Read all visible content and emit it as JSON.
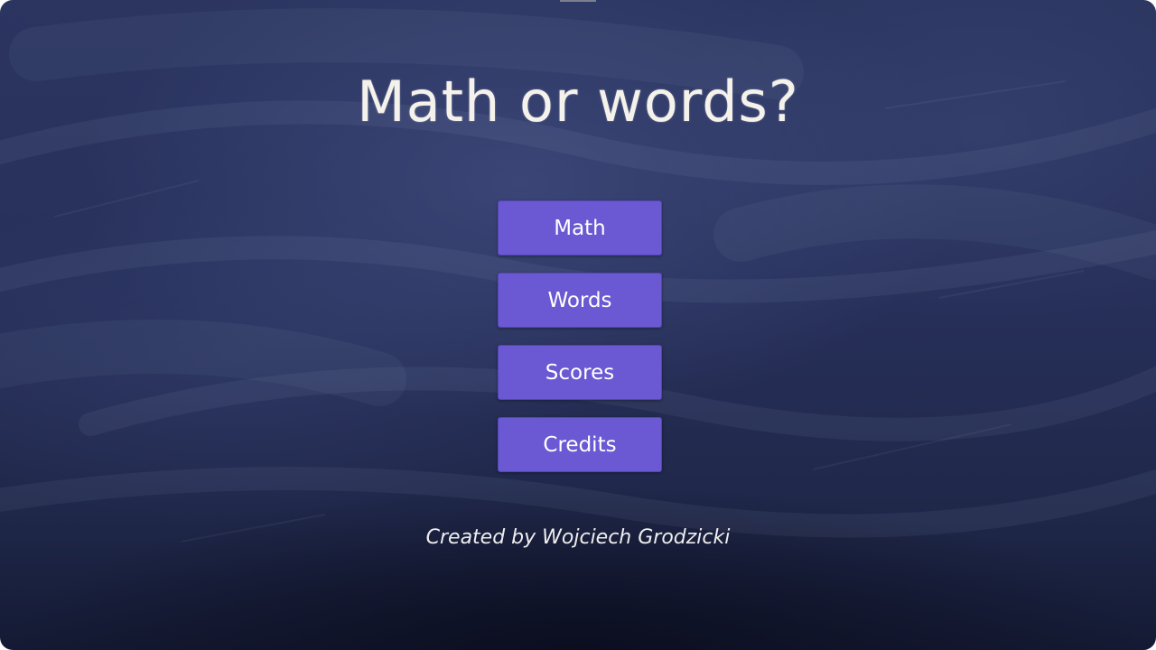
{
  "title": "Math or words?",
  "menu": {
    "items": [
      {
        "label": "Math"
      },
      {
        "label": "Words"
      },
      {
        "label": "Scores"
      },
      {
        "label": "Credits"
      }
    ]
  },
  "footer": {
    "credit": "Created by Wojciech Grodzicki"
  },
  "colors": {
    "background": "#27305a",
    "button": "#6a59d2",
    "text": "#f4f2ea"
  }
}
